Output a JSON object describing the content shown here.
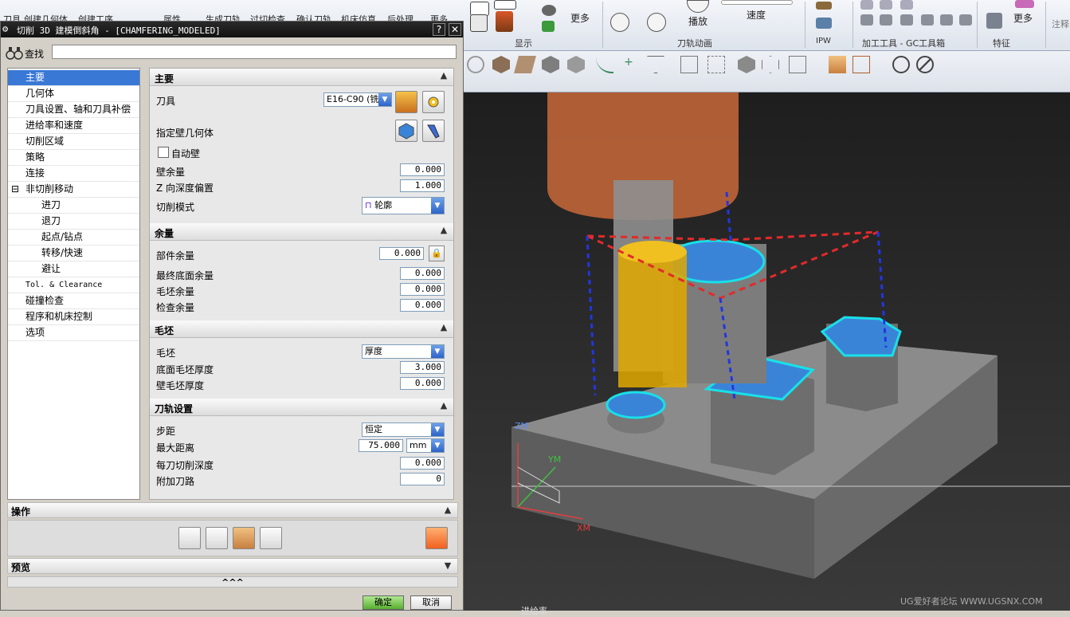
{
  "ribbon": {
    "top_row_left": [
      "刀具",
      "创建几何体",
      "创建工序",
      "属性",
      "生成刀轨",
      "过切检查",
      "确认刀轨",
      "机床仿真",
      "后处理",
      "更多"
    ],
    "display_group": "显示",
    "display_more": "更多",
    "animation_group": "刀轨动画",
    "play": "播放",
    "speed": "速度",
    "ipw_group": "IPW",
    "gc_group": "加工工具 - GC工具箱",
    "feature_group": "特征",
    "feature_more": "更多",
    "annotation": "注释"
  },
  "dialog": {
    "title": "切削 3D 建模倒斜角 - [CHAMFERING_MODELED]",
    "help": "?",
    "close": "✕",
    "find_label": "查找",
    "find_value": ""
  },
  "tree": {
    "items": [
      {
        "label": "主要",
        "level": 0,
        "selected": true
      },
      {
        "label": "几何体",
        "level": 0
      },
      {
        "label": "刀具设置、轴和刀具补偿",
        "level": 0
      },
      {
        "label": "进给率和速度",
        "level": 0
      },
      {
        "label": "切削区域",
        "level": 0
      },
      {
        "label": "策略",
        "level": 0
      },
      {
        "label": "连接",
        "level": 0
      },
      {
        "label": "非切削移动",
        "level": 0,
        "expander": "⊟"
      },
      {
        "label": "进刀",
        "level": 1
      },
      {
        "label": "退刀",
        "level": 1
      },
      {
        "label": "起点/钻点",
        "level": 1
      },
      {
        "label": "转移/快速",
        "level": 1
      },
      {
        "label": "避让",
        "level": 1
      },
      {
        "label": "Tol. & Clearance",
        "level": 0
      },
      {
        "label": "碰撞检查",
        "level": 0
      },
      {
        "label": "程序和机床控制",
        "level": 0
      },
      {
        "label": "选项",
        "level": 0
      }
    ]
  },
  "panel": {
    "main": {
      "header": "主要",
      "tool_label": "刀具",
      "tool_value": "E16-C90 (铣",
      "wall_geom_label": "指定壁几何体",
      "auto_wall_label": "自动壁",
      "wall_stock_label": "壁余量",
      "wall_stock": "0.000",
      "z_offset_label": "Z 向深度偏置",
      "z_offset": "1.000",
      "cut_pattern_label": "切削模式",
      "cut_pattern": "轮廓"
    },
    "stock": {
      "header": "余量",
      "part_stock_label": "部件余量",
      "part_stock": "0.000",
      "floor_stock_label": "最终底面余量",
      "floor_stock": "0.000",
      "blank_stock_label": "毛坯余量",
      "blank_stock": "0.000",
      "check_stock_label": "检查余量",
      "check_stock": "0.000"
    },
    "blank": {
      "header": "毛坯",
      "blank_label": "毛坯",
      "blank_value": "厚度",
      "floor_thickness_label": "底面毛坯厚度",
      "floor_thickness": "3.000",
      "wall_thickness_label": "壁毛坯厚度",
      "wall_thickness": "0.000"
    },
    "path": {
      "header": "刀轨设置",
      "stepover_label": "步距",
      "stepover_value": "恒定",
      "max_dist_label": "最大距离",
      "max_dist": "75.000",
      "max_dist_unit": "mm",
      "depth_label": "每刀切削深度",
      "depth": "0.000",
      "extra_label": "附加刀路",
      "extra": "0"
    }
  },
  "operations": {
    "header": "操作"
  },
  "preview": {
    "header": "预览",
    "collapse": "^^^"
  },
  "buttons": {
    "ok": "确定",
    "cancel": "取消"
  },
  "viewport": {
    "axis_z": "ZM",
    "axis_y": "YM",
    "axis_x": "XM",
    "watermark": "UG爱好者论坛 WWW.UGSNX.COM",
    "status": "进给率"
  },
  "colors": {
    "accent": "#3a78d6",
    "tool": "#c8683a",
    "part": "#8a8a8a",
    "toolpath_cyan": "#19e0e8"
  }
}
